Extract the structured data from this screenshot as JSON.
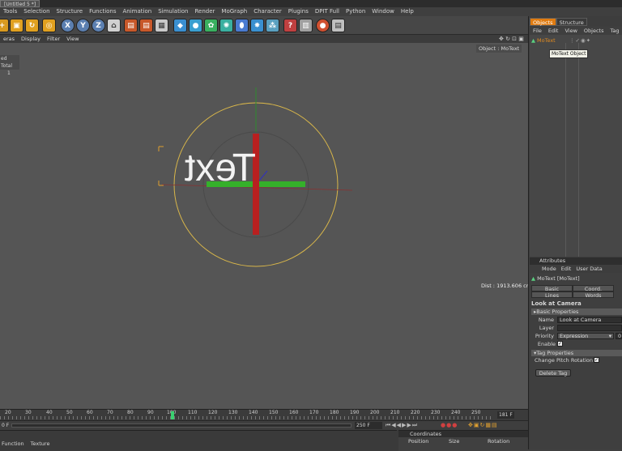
{
  "window": {
    "title_tab": "[Untitled 5 *]"
  },
  "menubar": [
    "Tools",
    "Selection",
    "Structure",
    "Functions",
    "Animation",
    "Simulation",
    "Render",
    "MoGraph",
    "Character",
    "Plugins",
    "DPIT Full",
    "Python",
    "Window",
    "Help"
  ],
  "toolbar": {
    "axis_x": "X",
    "axis_y": "Y",
    "axis_z": "Z"
  },
  "viewport_menu": [
    "eras",
    "Display",
    "Filter",
    "View"
  ],
  "viewport": {
    "hud_total_label": "ed Total",
    "hud_total_value": "1",
    "object_label": "Object : MoText",
    "distance": "Dist : 1913.606 cm",
    "text_object": "Text"
  },
  "timeline": {
    "ticks": [
      "20",
      "30",
      "40",
      "50",
      "60",
      "70",
      "80",
      "90",
      "100",
      "110",
      "120",
      "130",
      "140",
      "150",
      "160",
      "170",
      "180",
      "190",
      "200",
      "210",
      "220",
      "230",
      "240",
      "250"
    ],
    "end_frame": "181 F"
  },
  "playbar": {
    "start_frame": "0 F",
    "max_frame": "250 F"
  },
  "bottom_left": {
    "menu": [
      "Function",
      "Texture"
    ]
  },
  "coordinates": {
    "title": "Coordinates",
    "columns": [
      "Position",
      "Size",
      "Rotation"
    ]
  },
  "objects_panel": {
    "tabs": [
      "Objects",
      "Structure"
    ],
    "menu": [
      "File",
      "Edit",
      "View",
      "Objects",
      "Tag"
    ],
    "item": "MoText",
    "tooltip": "MoText Object"
  },
  "attributes": {
    "title": "Attributes",
    "menu": [
      "Mode",
      "Edit",
      "User Data"
    ],
    "object_name": "MoText [MoText]",
    "tabs": [
      "Basic",
      "Coord.",
      "Lines",
      "Words"
    ],
    "tag_title": "Look at Camera",
    "basic_section": "Basic Properties",
    "name_label": "Name",
    "name_value": "Look at Camera",
    "layer_label": "Layer",
    "priority_label": "Priority",
    "priority_value": "Expression",
    "priority_num": "0",
    "enable_label": "Enable",
    "tag_section": "Tag Properties",
    "pitch_label": "Change Pitch Rotation",
    "delete_button": "Delete Tag"
  },
  "colors": {
    "accent": "#e07b10",
    "viewport": "#555555",
    "circle": "#d8b64a",
    "y_axis": "#b82020",
    "x_axis": "#35b02a"
  }
}
